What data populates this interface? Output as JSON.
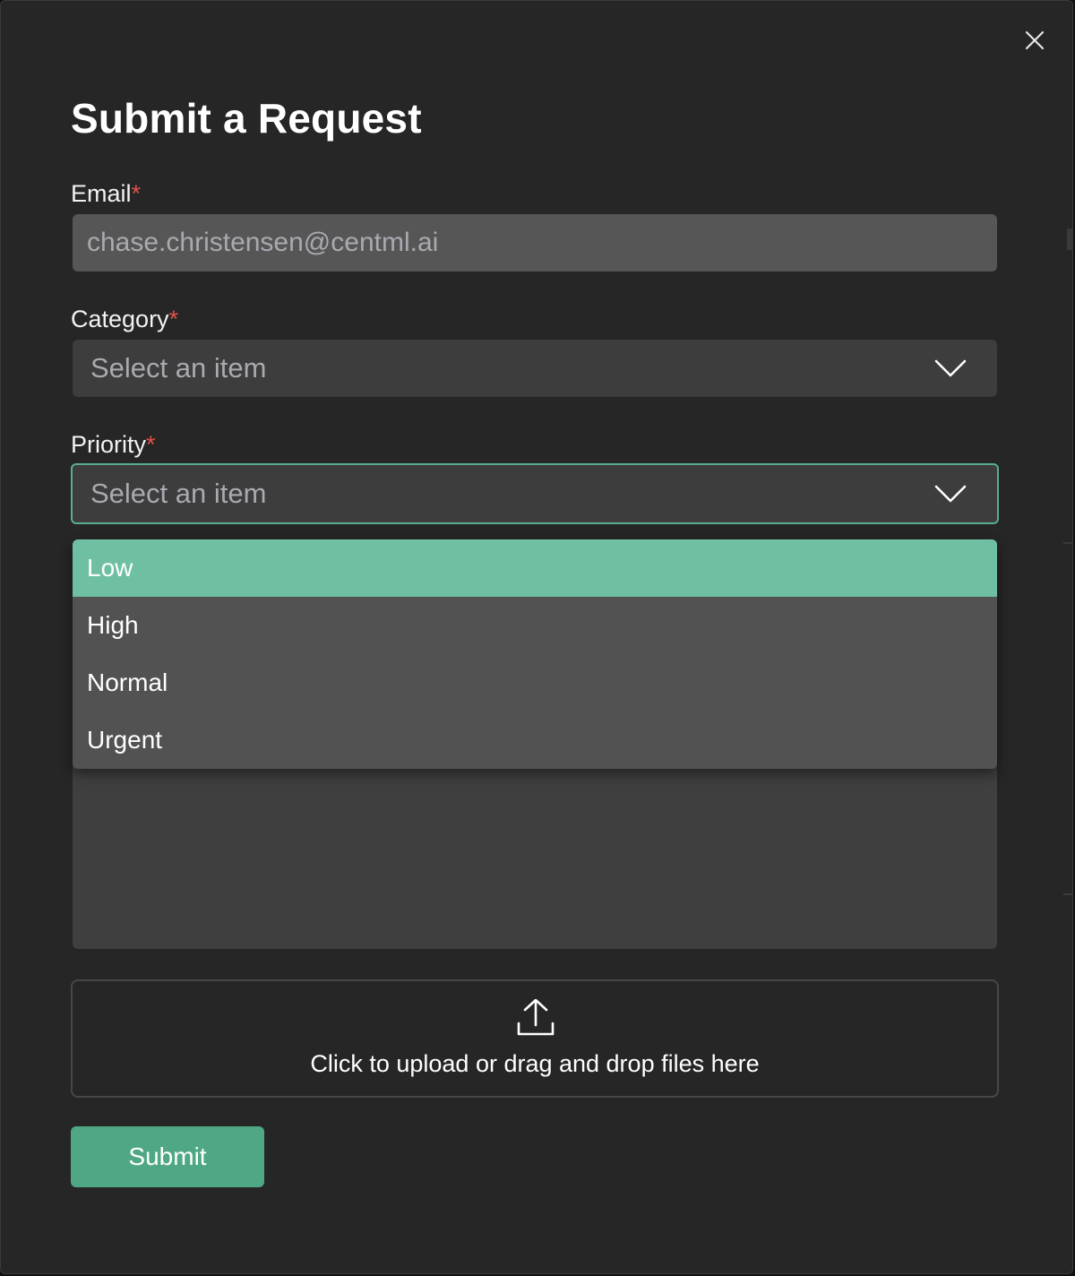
{
  "modal": {
    "title": "Submit a Request",
    "close_icon": "close-icon"
  },
  "form": {
    "email": {
      "label": "Email",
      "required_mark": "*",
      "value": "chase.christensen@centml.ai"
    },
    "category": {
      "label": "Category",
      "required_mark": "*",
      "placeholder": "Select an item",
      "icon": "chevron-down-icon"
    },
    "priority": {
      "label": "Priority",
      "required_mark": "*",
      "placeholder": "Select an item",
      "icon": "chevron-down-icon",
      "state": "open",
      "options": [
        {
          "label": "Low",
          "highlighted": true
        },
        {
          "label": "High",
          "highlighted": false
        },
        {
          "label": "Normal",
          "highlighted": false
        },
        {
          "label": "Urgent",
          "highlighted": false
        }
      ]
    },
    "upload": {
      "icon": "upload-icon",
      "text": "Click to upload or drag and drop files here"
    },
    "submit_label": "Submit"
  },
  "colors": {
    "modal_background": "#262626",
    "accent": "#4fa883",
    "highlight": "#6fc0a3",
    "required": "#e2504a",
    "focus_border": "#58ae8f"
  }
}
